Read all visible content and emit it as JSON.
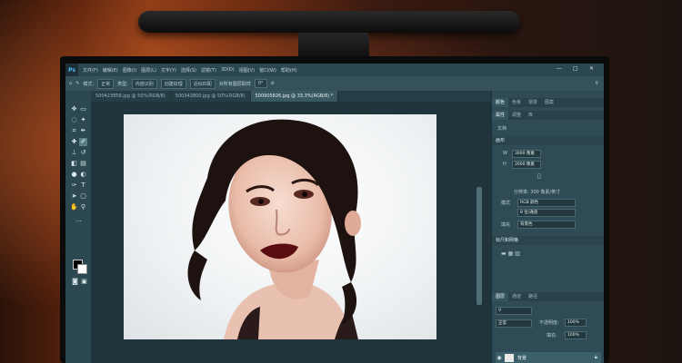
{
  "app": {
    "menu": [
      "文件(F)",
      "编辑(E)",
      "图像(I)",
      "图层(L)",
      "文字(Y)",
      "选择(S)",
      "滤镜(T)",
      "3D(D)",
      "视图(V)",
      "窗口(W)",
      "帮助(H)"
    ],
    "window_controls": [
      "—",
      "□",
      "✕"
    ]
  },
  "options_bar": {
    "mode_label": "模式:",
    "mode_value": "正常",
    "type_label": "类型:",
    "buttons": [
      "内容识别",
      "创建纹理",
      "近似匹配"
    ],
    "sample_all": "对所有图层取样",
    "angle_value": "0°"
  },
  "document_tabs": [
    {
      "label": "500423858.jpg @ 50%(RGB/8)",
      "active": false
    },
    {
      "label": "500342800.jpg @ 50%(RGB/8)",
      "active": false
    },
    {
      "label": "500905826.jpg @ 33.3%(RGB/8) *",
      "active": true
    }
  ],
  "tools": [
    "move-icon",
    "marquee-icon",
    "lasso-icon",
    "quick-select-icon",
    "crop-icon",
    "eyedropper-icon",
    "healing-icon",
    "brush-icon",
    "stamp-icon",
    "history-brush-icon",
    "eraser-icon",
    "gradient-icon",
    "blur-icon",
    "dodge-icon",
    "pen-icon",
    "type-icon",
    "path-select-icon",
    "shape-icon",
    "hand-icon",
    "zoom-icon",
    "more-icon"
  ],
  "properties_panel": {
    "tabs": [
      "属性",
      "调整",
      "库"
    ],
    "subtabs": [
      "颜色",
      "色板",
      "渐变",
      "图案"
    ],
    "document_label": "文档",
    "canvas_section": "画布",
    "width_label": "W",
    "width_value": "3000 像素",
    "height_label": "H",
    "height_value": "2000 像素",
    "resolution": "分辨率: 300 像素/英寸",
    "mode_label": "模式",
    "mode_value": "RGB 颜色",
    "bit_depth": "8 位/通道",
    "fill_label": "填充",
    "fill_value": "背景色",
    "rulers_section": "标尺和网格"
  },
  "layers_panel": {
    "tabs": [
      "图层",
      "通道",
      "路径"
    ],
    "blend_mode": "正常",
    "opacity_label": "不透明度:",
    "opacity_value": "100%",
    "fill_label": "填充:",
    "fill_value": "100%",
    "layer_name": "背景"
  }
}
